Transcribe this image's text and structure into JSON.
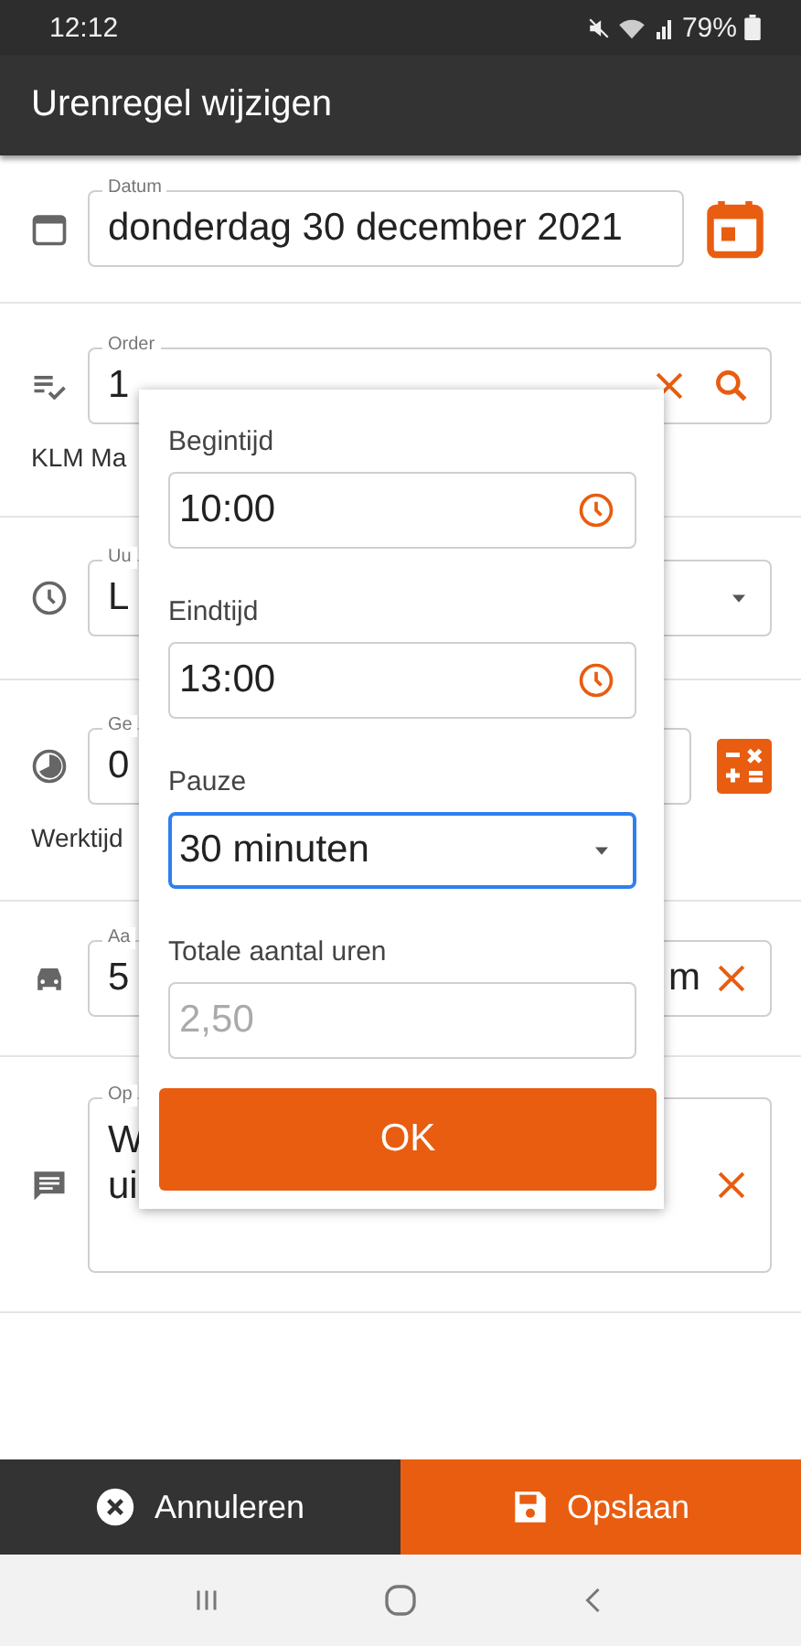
{
  "status_bar": {
    "time": "12:12",
    "battery": "79%"
  },
  "app_bar": {
    "title": "Urenregel wijzigen"
  },
  "form": {
    "rows": [
      {
        "kind": "date",
        "label": "Datum",
        "value": "donderdag 30 december 2021"
      },
      {
        "kind": "order",
        "label": "Order",
        "value": "1",
        "note": "KLM Ma"
      },
      {
        "kind": "select",
        "label": "Uu",
        "value": "L"
      },
      {
        "kind": "calc",
        "label": "Ge",
        "value": "0",
        "note": "Werktijd"
      },
      {
        "kind": "distance",
        "label": "Aa",
        "value": "5",
        "suffix": "m"
      },
      {
        "kind": "text",
        "label": "Op",
        "lines": [
          "W",
          "ui"
        ]
      }
    ]
  },
  "dialog": {
    "fields": [
      {
        "kind": "time",
        "label": "Begintijd",
        "value": "10:00",
        "focused": false,
        "disabled": false
      },
      {
        "kind": "time",
        "label": "Eindtijd",
        "value": "13:00",
        "focused": false,
        "disabled": false
      },
      {
        "kind": "select",
        "label": "Pauze",
        "value": "30 minuten",
        "focused": true,
        "disabled": false
      },
      {
        "kind": "plain",
        "label": "Totale aantal uren",
        "value": "2,50",
        "focused": false,
        "disabled": true
      }
    ],
    "ok": "OK"
  },
  "bottom_bar": {
    "cancel": "Annuleren",
    "save": "Opslaan"
  }
}
